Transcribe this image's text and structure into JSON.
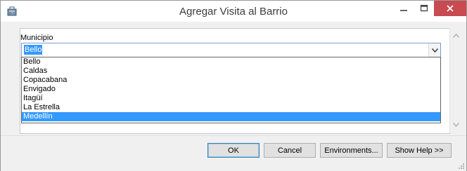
{
  "window": {
    "title": "Agregar Visita al Barrio",
    "icon": "toolbox-icon",
    "controls": [
      "minimize-icon",
      "maximize-icon",
      "close-icon"
    ],
    "close_color": "#c74b50"
  },
  "form": {
    "municipio_label": "Municipio",
    "municipio_value": "Bello",
    "dropdown": {
      "options": [
        "Bello",
        "Caldas",
        "Copacabana",
        "Envigado",
        "Itagüí",
        "La Estrella",
        "Medellín"
      ],
      "highlighted": "Medellín",
      "highlight_color": "#3399ff"
    }
  },
  "footer": {
    "ok_label": "OK",
    "cancel_label": "Cancel",
    "environments_label": "Environments...",
    "help_label": "Show Help >>"
  }
}
